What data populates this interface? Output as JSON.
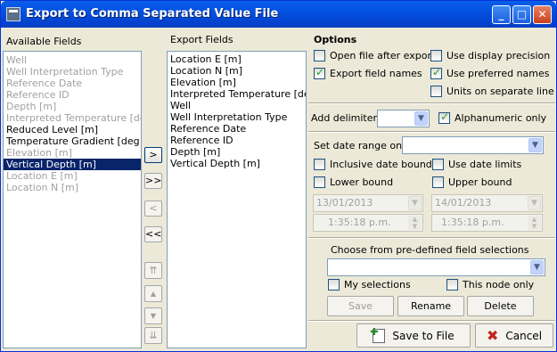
{
  "window": {
    "title": "Export to Comma Separated Value File"
  },
  "available_fields": {
    "header": "Available Fields",
    "items": [
      {
        "label": "Well",
        "state": "dim"
      },
      {
        "label": "Well Interpretation Type",
        "state": "dim"
      },
      {
        "label": "Reference Date",
        "state": "dim"
      },
      {
        "label": "Reference ID",
        "state": "dim"
      },
      {
        "label": "Depth [m]",
        "state": "dim"
      },
      {
        "label": "Interpreted Temperature [deg C]",
        "state": "dim"
      },
      {
        "label": "Reduced Level [m]",
        "state": "normal"
      },
      {
        "label": "Temperature Gradient [deg C/m]",
        "state": "normal"
      },
      {
        "label": "Elevation [m]",
        "state": "dim"
      },
      {
        "label": "Vertical Depth [m]",
        "state": "selected"
      },
      {
        "label": "Location E [m]",
        "state": "dim"
      },
      {
        "label": "Location N [m]",
        "state": "dim"
      }
    ]
  },
  "move_buttons": {
    "add": ">",
    "add_all": ">>",
    "remove": "<",
    "remove_all": "<<",
    "top": "⇈",
    "up": "▲",
    "down": "▼",
    "bottom": "⇊"
  },
  "export_fields": {
    "header": "Export Fields",
    "items": [
      "Location E [m]",
      "Location N [m]",
      "Elevation [m]",
      "Interpreted Temperature [deg C]",
      "Well",
      "Well Interpretation Type",
      "Reference Date",
      "Reference ID",
      "Depth [m]",
      "Vertical Depth [m]"
    ]
  },
  "options": {
    "header": "Options",
    "open_file_after_export": {
      "label": "Open file after export",
      "checked": false
    },
    "use_display_precision": {
      "label": "Use display precision",
      "checked": false
    },
    "export_field_names": {
      "label": "Export field names",
      "checked": true
    },
    "use_preferred_names": {
      "label": "Use preferred names",
      "checked": true
    },
    "units_on_separate_line": {
      "label": "Units on separate line",
      "checked": false
    },
    "add_delimiters_label": "Add delimiters",
    "add_delimiters_value": "",
    "alphanumeric_only": {
      "label": "Alphanumeric only",
      "checked": true
    },
    "set_date_range_label": "Set date range on",
    "set_date_range_value": "",
    "inclusive_date_bounds": {
      "label": "Inclusive date bounds",
      "checked": false
    },
    "use_date_limits": {
      "label": "Use date limits",
      "checked": false
    },
    "lower_bound": {
      "label": "Lower bound",
      "checked": false
    },
    "upper_bound": {
      "label": "Upper bound",
      "checked": false
    },
    "lower_date": "13/01/2013",
    "upper_date": "14/01/2013",
    "lower_time": "1:35:18 p.m.",
    "upper_time": "1:35:18 p.m."
  },
  "predefined": {
    "header": "Choose from pre-defined field selections",
    "value": "",
    "my_selections": {
      "label": "My selections",
      "checked": false
    },
    "this_node_only": {
      "label": "This node only",
      "checked": false
    },
    "save_label": "Save",
    "rename_label": "Rename",
    "delete_label": "Delete"
  },
  "footer": {
    "save_to_file_label": "Save to File",
    "cancel_label": "Cancel"
  },
  "colors": {
    "title_bar": "#0454e3",
    "selection": "#0a246a",
    "check": "#21a121"
  }
}
